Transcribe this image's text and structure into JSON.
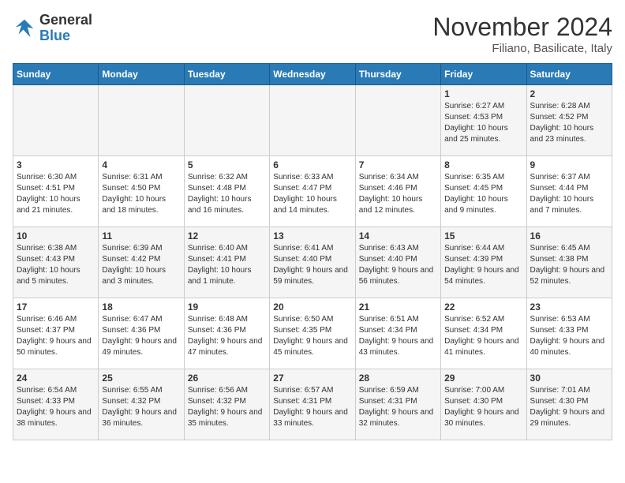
{
  "logo": {
    "line1": "General",
    "line2": "Blue"
  },
  "title": "November 2024",
  "location": "Filiano, Basilicate, Italy",
  "days_of_week": [
    "Sunday",
    "Monday",
    "Tuesday",
    "Wednesday",
    "Thursday",
    "Friday",
    "Saturday"
  ],
  "weeks": [
    [
      {
        "day": "",
        "info": ""
      },
      {
        "day": "",
        "info": ""
      },
      {
        "day": "",
        "info": ""
      },
      {
        "day": "",
        "info": ""
      },
      {
        "day": "",
        "info": ""
      },
      {
        "day": "1",
        "info": "Sunrise: 6:27 AM\nSunset: 4:53 PM\nDaylight: 10 hours and 25 minutes."
      },
      {
        "day": "2",
        "info": "Sunrise: 6:28 AM\nSunset: 4:52 PM\nDaylight: 10 hours and 23 minutes."
      }
    ],
    [
      {
        "day": "3",
        "info": "Sunrise: 6:30 AM\nSunset: 4:51 PM\nDaylight: 10 hours and 21 minutes."
      },
      {
        "day": "4",
        "info": "Sunrise: 6:31 AM\nSunset: 4:50 PM\nDaylight: 10 hours and 18 minutes."
      },
      {
        "day": "5",
        "info": "Sunrise: 6:32 AM\nSunset: 4:48 PM\nDaylight: 10 hours and 16 minutes."
      },
      {
        "day": "6",
        "info": "Sunrise: 6:33 AM\nSunset: 4:47 PM\nDaylight: 10 hours and 14 minutes."
      },
      {
        "day": "7",
        "info": "Sunrise: 6:34 AM\nSunset: 4:46 PM\nDaylight: 10 hours and 12 minutes."
      },
      {
        "day": "8",
        "info": "Sunrise: 6:35 AM\nSunset: 4:45 PM\nDaylight: 10 hours and 9 minutes."
      },
      {
        "day": "9",
        "info": "Sunrise: 6:37 AM\nSunset: 4:44 PM\nDaylight: 10 hours and 7 minutes."
      }
    ],
    [
      {
        "day": "10",
        "info": "Sunrise: 6:38 AM\nSunset: 4:43 PM\nDaylight: 10 hours and 5 minutes."
      },
      {
        "day": "11",
        "info": "Sunrise: 6:39 AM\nSunset: 4:42 PM\nDaylight: 10 hours and 3 minutes."
      },
      {
        "day": "12",
        "info": "Sunrise: 6:40 AM\nSunset: 4:41 PM\nDaylight: 10 hours and 1 minute."
      },
      {
        "day": "13",
        "info": "Sunrise: 6:41 AM\nSunset: 4:40 PM\nDaylight: 9 hours and 59 minutes."
      },
      {
        "day": "14",
        "info": "Sunrise: 6:43 AM\nSunset: 4:40 PM\nDaylight: 9 hours and 56 minutes."
      },
      {
        "day": "15",
        "info": "Sunrise: 6:44 AM\nSunset: 4:39 PM\nDaylight: 9 hours and 54 minutes."
      },
      {
        "day": "16",
        "info": "Sunrise: 6:45 AM\nSunset: 4:38 PM\nDaylight: 9 hours and 52 minutes."
      }
    ],
    [
      {
        "day": "17",
        "info": "Sunrise: 6:46 AM\nSunset: 4:37 PM\nDaylight: 9 hours and 50 minutes."
      },
      {
        "day": "18",
        "info": "Sunrise: 6:47 AM\nSunset: 4:36 PM\nDaylight: 9 hours and 49 minutes."
      },
      {
        "day": "19",
        "info": "Sunrise: 6:48 AM\nSunset: 4:36 PM\nDaylight: 9 hours and 47 minutes."
      },
      {
        "day": "20",
        "info": "Sunrise: 6:50 AM\nSunset: 4:35 PM\nDaylight: 9 hours and 45 minutes."
      },
      {
        "day": "21",
        "info": "Sunrise: 6:51 AM\nSunset: 4:34 PM\nDaylight: 9 hours and 43 minutes."
      },
      {
        "day": "22",
        "info": "Sunrise: 6:52 AM\nSunset: 4:34 PM\nDaylight: 9 hours and 41 minutes."
      },
      {
        "day": "23",
        "info": "Sunrise: 6:53 AM\nSunset: 4:33 PM\nDaylight: 9 hours and 40 minutes."
      }
    ],
    [
      {
        "day": "24",
        "info": "Sunrise: 6:54 AM\nSunset: 4:33 PM\nDaylight: 9 hours and 38 minutes."
      },
      {
        "day": "25",
        "info": "Sunrise: 6:55 AM\nSunset: 4:32 PM\nDaylight: 9 hours and 36 minutes."
      },
      {
        "day": "26",
        "info": "Sunrise: 6:56 AM\nSunset: 4:32 PM\nDaylight: 9 hours and 35 minutes."
      },
      {
        "day": "27",
        "info": "Sunrise: 6:57 AM\nSunset: 4:31 PM\nDaylight: 9 hours and 33 minutes."
      },
      {
        "day": "28",
        "info": "Sunrise: 6:59 AM\nSunset: 4:31 PM\nDaylight: 9 hours and 32 minutes."
      },
      {
        "day": "29",
        "info": "Sunrise: 7:00 AM\nSunset: 4:30 PM\nDaylight: 9 hours and 30 minutes."
      },
      {
        "day": "30",
        "info": "Sunrise: 7:01 AM\nSunset: 4:30 PM\nDaylight: 9 hours and 29 minutes."
      }
    ]
  ]
}
